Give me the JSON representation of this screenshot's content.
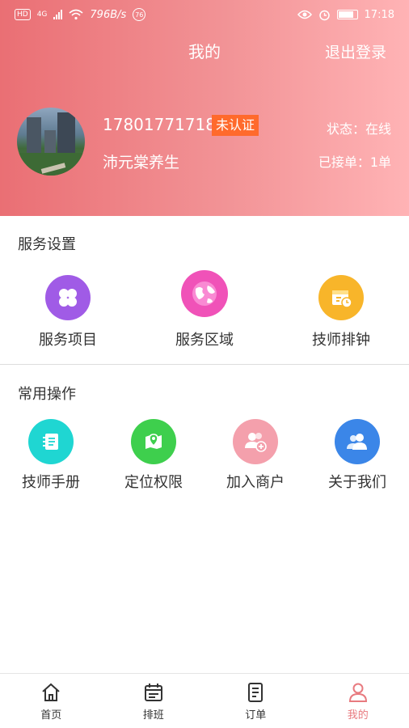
{
  "status_bar": {
    "hd": "HD",
    "network": "4G",
    "speed": "796B/s",
    "notification_count": "76",
    "time": "17:18",
    "battery_label": "85"
  },
  "header": {
    "title": "我的",
    "logout_label": "退出登录",
    "phone": "17801771718",
    "verify_badge": "未认证",
    "shop_name": "沛元棠养生",
    "status_text": "状态：在线",
    "orders_text": "已接单：1单",
    "colors": {
      "gradient_start": "#ea6f74",
      "gradient_end": "#ffb3b5",
      "badge": "#ff6a2c"
    }
  },
  "service_settings": {
    "title": "服务设置",
    "items": [
      {
        "label": "服务项目",
        "icon": "four-petal-icon",
        "color": "#a05be6"
      },
      {
        "label": "服务区域",
        "icon": "globe-icon",
        "color": "#f052b8"
      },
      {
        "label": "技师排钟",
        "icon": "calendar-clock-icon",
        "color": "#f8b52a"
      }
    ]
  },
  "common_ops": {
    "title": "常用操作",
    "items": [
      {
        "label": "技师手册",
        "icon": "notebook-icon",
        "color": "#1fd6d2"
      },
      {
        "label": "定位权限",
        "icon": "map-pin-icon",
        "color": "#3ecf4d"
      },
      {
        "label": "加入商户",
        "icon": "users-add-icon",
        "color": "#f4a0ac"
      },
      {
        "label": "关于我们",
        "icon": "users-icon",
        "color": "#3b86e8"
      }
    ]
  },
  "tabbar": {
    "active_color": "#e87a7f",
    "tabs": [
      {
        "label": "首页",
        "icon": "home-icon"
      },
      {
        "label": "排班",
        "icon": "schedule-icon"
      },
      {
        "label": "订单",
        "icon": "document-icon"
      },
      {
        "label": "我的",
        "icon": "person-icon",
        "active": true
      }
    ]
  }
}
